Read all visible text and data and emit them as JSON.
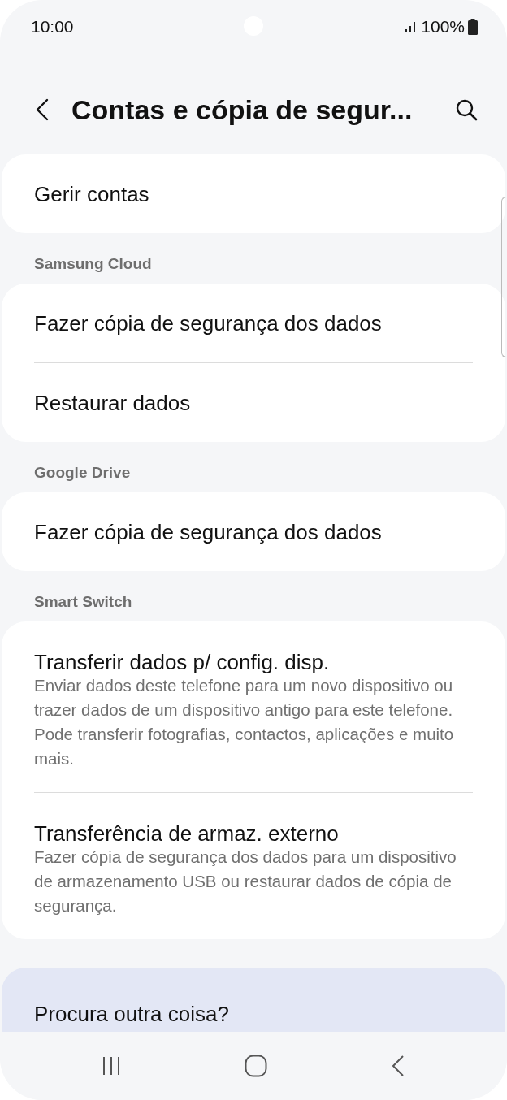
{
  "status_bar": {
    "time": "10:00",
    "battery": "100%"
  },
  "header": {
    "title": "Contas e cópia de segur..."
  },
  "groups": [
    {
      "items": [
        {
          "title": "Gerir contas"
        }
      ]
    },
    {
      "heading": "Samsung Cloud",
      "items": [
        {
          "title": "Fazer cópia de segurança dos dados"
        },
        {
          "title": "Restaurar dados"
        }
      ]
    },
    {
      "heading": "Google Drive",
      "items": [
        {
          "title": "Fazer cópia de segurança dos dados"
        }
      ]
    },
    {
      "heading": "Smart Switch",
      "items": [
        {
          "title": "Transferir dados p/ config. disp.",
          "summary": "Enviar dados deste telefone para um novo dispositivo ou trazer dados de um dispositivo antigo para este telefone. Pode transferir fotografias, contactos, aplicações e muito mais."
        },
        {
          "title": "Transferência de armaz. externo",
          "summary": "Fazer cópia de segurança dos dados para um dispositivo de armazenamento USB ou restaurar dados de cópia de segurança."
        }
      ]
    }
  ],
  "suggestion": {
    "title": "Procura outra coisa?"
  }
}
